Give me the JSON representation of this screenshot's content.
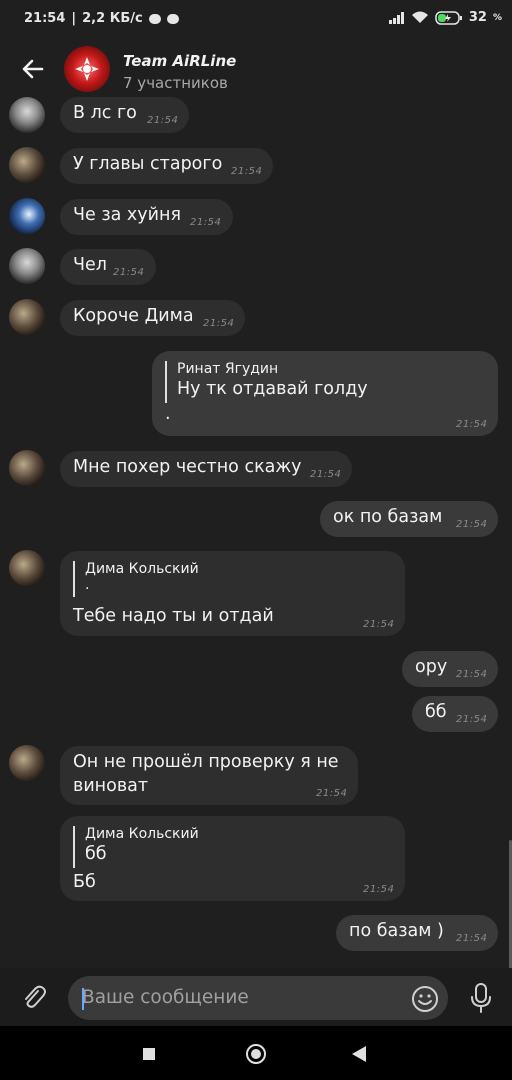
{
  "status": {
    "time": "21:54",
    "speed": "2,2 КБ/с",
    "battery": "32",
    "battery_unit": "%"
  },
  "header": {
    "title": "Team AiRLine",
    "subtitle": "7 участников"
  },
  "messages": [
    {
      "text": "В лс го",
      "time": "21:54"
    },
    {
      "text": "У главы старого",
      "time": "21:54"
    },
    {
      "text": "Че за хуйня",
      "time": "21:54"
    },
    {
      "text": "Чел",
      "time": "21:54"
    },
    {
      "text": "Короче Дима",
      "time": "21:54"
    },
    {
      "quote_name": "Ринат Ягудин",
      "quote_text": "Ну тк отдавай голду",
      "text": ".",
      "time": "21:54"
    },
    {
      "text": "Мне похер честно скажу",
      "time": "21:54"
    },
    {
      "text": "ок по базам",
      "time": "21:54"
    },
    {
      "quote_name": "Дима Кольский",
      "quote_text": ".",
      "text": "Тебе надо ты и отдай",
      "time": "21:54"
    },
    {
      "text": "ору",
      "time": "21:54"
    },
    {
      "text": "бб",
      "time": "21:54"
    },
    {
      "text_line1": "Он не прошёл проверку я не",
      "text_line2": "виноват",
      "time": "21:54"
    },
    {
      "quote_name": "Дима Кольский",
      "quote_text": "бб",
      "text": "Бб",
      "time": "21:54"
    },
    {
      "text": "по базам )",
      "time": "21:54"
    }
  ],
  "composer": {
    "placeholder": "Ваше сообщение"
  },
  "icons": {
    "back": "arrow-left-icon",
    "attach": "paperclip-icon",
    "emoji": "smiley-icon",
    "mic": "microphone-icon"
  }
}
